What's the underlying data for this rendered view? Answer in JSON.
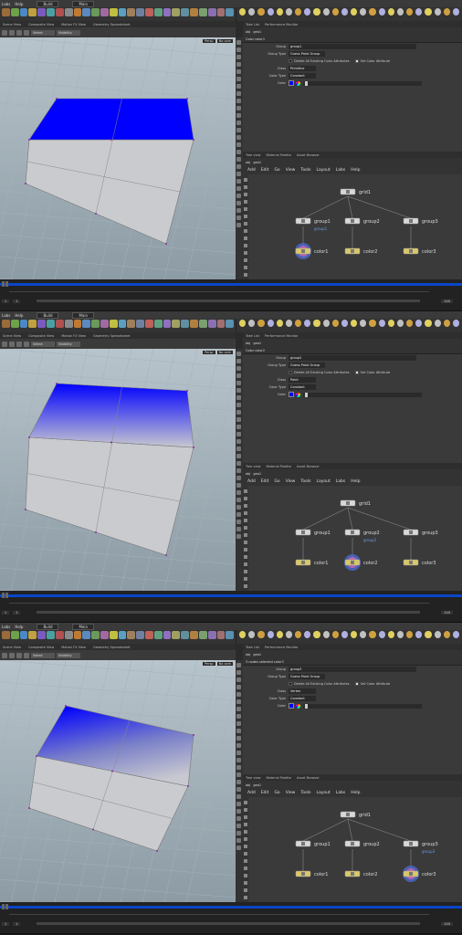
{
  "menu": [
    "Labs",
    "Help"
  ],
  "desktop": "Build",
  "desk_main": "Main",
  "viewport_tabs": [
    "Scene View",
    "Composite View",
    "Motion FX View",
    "Geometry Spreadsheet"
  ],
  "viewport_buttons": [
    "Persp",
    "No cam"
  ],
  "viewport_selects": [
    "Select",
    "Visibility"
  ],
  "right_tabs": [
    "Take List",
    "Performance Monitor"
  ],
  "path": [
    "obj",
    "geo1"
  ],
  "network_tabs": [
    "Tree view",
    "Material Palette",
    "Asset Browser"
  ],
  "network_menu": [
    "Add",
    "Edit",
    "Go",
    "View",
    "Tools",
    "Layout",
    "Labs",
    "Help"
  ],
  "param_labels": {
    "group": "Group",
    "group_type": "Group Type",
    "delete_attrs": "Delete All Existing Color Attributes",
    "set_color": "Set Color Attribute",
    "class": "Class",
    "color_type": "Color Type",
    "color": "Color"
  },
  "nodes": {
    "grid": "grid1",
    "group1": "group1",
    "group2": "group2",
    "group3": "group3",
    "color1": "color1",
    "color2": "color2",
    "color3": "color3",
    "group_sub": "group1"
  },
  "timeline": {
    "start": "1",
    "end": "240",
    "frame": "1"
  },
  "panels": [
    {
      "header": "Color  color1",
      "group_value": "group1",
      "group_type_value": "Guess Point Group",
      "class_value": "Primitive",
      "color_type_value": "Constant",
      "selected_color_node": "color1"
    },
    {
      "header": "Color  color2",
      "group_value": "group2",
      "group_type_value": "Guess Point Group",
      "class_value": "Point",
      "color_type_value": "Constant",
      "selected_color_node": "color2"
    },
    {
      "header": "3 nodes selected   color3",
      "group_value": "group3",
      "group_type_value": "Guess Point Group",
      "class_value": "Vertex",
      "color_type_value": "Constant",
      "selected_color_node": "color3"
    }
  ],
  "colors": {
    "accent_blue": "#0000ff",
    "timeline_blue": "#0a46c8",
    "node_yellow": "#d9c86a"
  }
}
